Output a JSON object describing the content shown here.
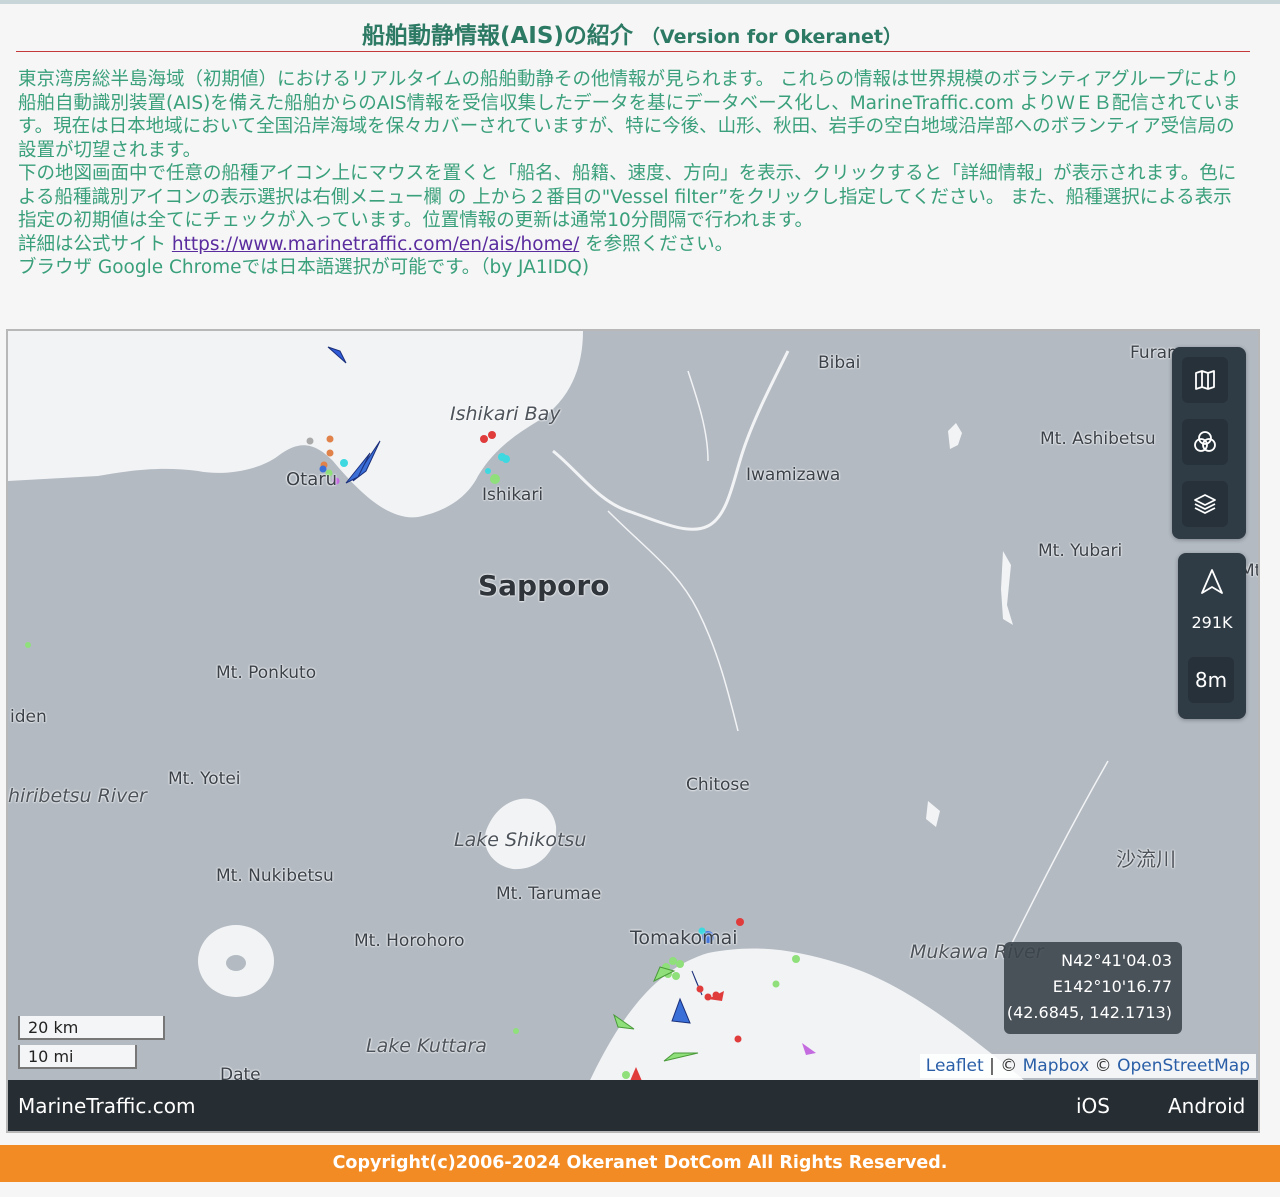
{
  "header": {
    "title": "船舶動静情報(AIS)の紹介",
    "subtitle": "（Version for Okeranet）"
  },
  "intro": {
    "line1": "東京湾房総半島海域（初期値）におけるリアルタイムの船舶動静その他情報が見られます。 これらの情報は世界規模のボランティアグループにより船舶自動識別装置(AIS)を備えた船舶からのAIS情報を受信収集したデータを基にデータベース化し、MarineTraffic.com よりＷＥＢ配信されています。現在は日本地域において全国沿岸海域を保々カバーされていますが、特に今後、山形、秋田、岩手の空白地域沿岸部へのボランティア受信局の設置が切望されます。",
    "line2": "下の地図画面中で任意の船種アイコン上にマウスを置くと「船名、船籍、速度、方向」を表示、クリックすると「詳細情報」が表示されます。色による船種識別アイコンの表示選択は右側メニュー欄 の 上から２番目の\"Vessel filter”をクリックし指定してください。 また、船種選択による表示指定の初期値は全てにチェックが入っています。位置情報の更新は通常10分間隔で行われます。",
    "detail_prefix": "詳細は公式サイト ",
    "detail_link": "https://www.marinetraffic.com/en/ais/home/",
    "detail_suffix": " を参照ください。",
    "browser_note": "ブラウザ Google Chromeでは日本語選択が可能です。（by JA1IDQ)"
  },
  "map": {
    "labels": {
      "ishikari_bay": "Ishikari Bay",
      "otaru": "Otaru",
      "ishikari": "Ishikari",
      "bibai": "Bibai",
      "furano": "Furan",
      "iwamizawa": "Iwamizawa",
      "mt_ashibetsu": "Mt. Ashibetsu",
      "mt_yubari": "Mt. Yubari",
      "sapporo": "Sapporo",
      "mt_ponkuto": "Mt. Ponkuto",
      "iden": "iden",
      "mt_yotei": "Mt. Yotei",
      "shiribetsu": "hiribetsu River",
      "chitose": "Chitose",
      "lake_shikotsu": "Lake Shikotsu",
      "mt_nukibetsu": "Mt. Nukibetsu",
      "mt_tarumae": "Mt. Tarumae",
      "saru_river": "沙流川",
      "mt_horohoro": "Mt. Horohoro",
      "tomakomai": "Tomakomai",
      "mukawa_river": "Mukawa River",
      "lake_kuttara": "Lake Kuttara",
      "date": "Date",
      "mt_right": "Mt"
    },
    "controls": {
      "count": "291K",
      "refresh": "8m",
      "map_icon": "map-icon",
      "filter_icon": "vessel-filter-icon",
      "layers_icon": "layers-icon",
      "navigate_icon": "navigation-arrow-icon"
    },
    "coords": {
      "lat": "N42°41'04.03",
      "lon": "E142°10'16.77",
      "decimal": "(42.6845, 142.1713)"
    },
    "scale": {
      "km": "20 km",
      "mi": "10 mi"
    },
    "attribution": {
      "leaflet": "Leaflet",
      "sep1": " | © ",
      "mapbox": "Mapbox",
      "sep2": " © ",
      "osm": "OpenStreetMap"
    },
    "bottom_bar": {
      "brand": "MarineTraffic.com",
      "ios": "iOS",
      "android": "Android"
    },
    "colors": {
      "land": "#b3bac2",
      "sea": "#f2f3f5",
      "cargo": "#4a90e2",
      "tanker": "#e03c3c",
      "passenger": "#3a6fd8",
      "fishing": "#8fe07a",
      "pleasure": "#c46be0"
    }
  },
  "footer": {
    "copyright": "Copyright(c)2006-2024 Okeranet DotCom All Rights Reserved."
  }
}
